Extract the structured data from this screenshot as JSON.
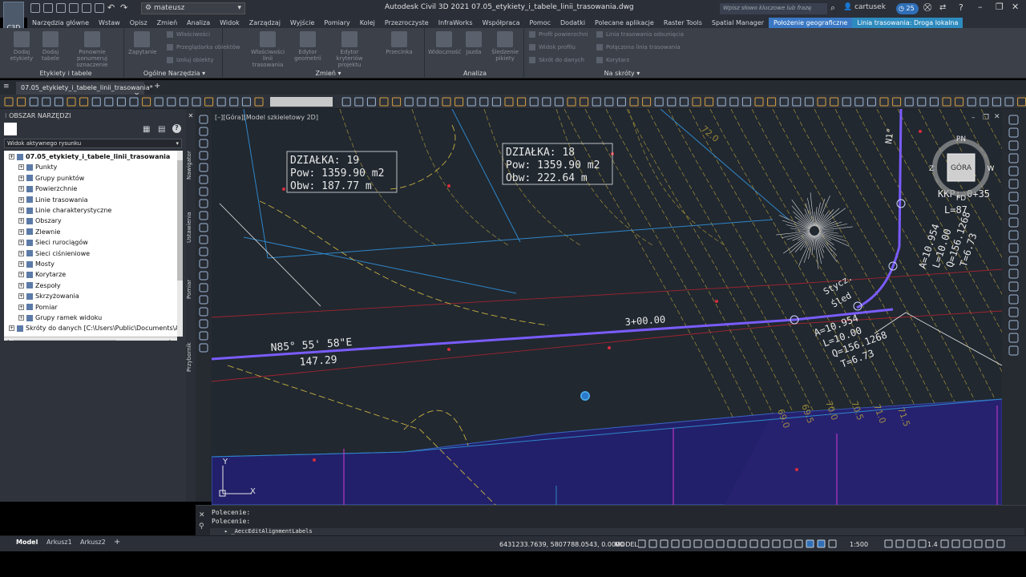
{
  "app": {
    "logo": "C3D",
    "workspace": "mateusz",
    "title": "Autodesk Civil 3D 2021   07.05_etykiety_i_tabele_linii_trasowania.dwg",
    "search_placeholder": "Wpisz słowo kluczowe lub frazę",
    "user": "cartusek",
    "notification_count": "25"
  },
  "ribbon_tabs": [
    "Narzędzia główne",
    "Wstaw",
    "Opisz",
    "Zmień",
    "Analiza",
    "Widok",
    "Zarządzaj",
    "Wyjście",
    "Pomiary",
    "Kolej",
    "Przezroczyste",
    "InfraWorks",
    "Współpraca",
    "Pomoc",
    "Dodatki",
    "Polecane aplikacje",
    "Raster Tools",
    "Spatial Manager",
    "Położenie geograficzne",
    "Linia trasowania: Droga lokalna"
  ],
  "ribbon": {
    "panel1": {
      "title": "Etykiety i tabele",
      "buttons": [
        "Dodaj etykiety",
        "Dodaj tabele",
        "Ponownie ponumeruj oznaczenie"
      ]
    },
    "panel2": {
      "title": "Ogólne Narzędzia",
      "buttons": [
        "Zapytanie"
      ],
      "small": [
        "Właściwości",
        "Przeglądarka obiektów",
        "Izoluj obiekty"
      ]
    },
    "panel3": {
      "title": "Zmień",
      "buttons": [
        "Właściwości linii trasowania",
        "Edytor geometrii",
        "Edytor kryteriów projektu",
        "Przecinka"
      ]
    },
    "panel4": {
      "title": "Analiza",
      "buttons": [
        "Widoczność",
        "Jazda",
        "Śledzenie pikiety"
      ]
    },
    "panel5": {
      "title": "Na skróty",
      "small": [
        "Profil powierzchni",
        "Widok profilu",
        "Skrót do danych",
        "Linia trasowania odsunięcia",
        "Połączona linia trasowania",
        "Korytarz"
      ]
    }
  },
  "document_tab": "07.05_etykiety_i_tabele_linii_trasowania*",
  "toolspace": {
    "title": "OBSZAR NARZĘDZI",
    "view_combo": "Widok aktywnego rysunku",
    "tree": [
      {
        "label": "07.05_etykiety_i_tabele_linii_trasowania",
        "level": 0,
        "bold": true
      },
      {
        "label": "Punkty",
        "level": 1
      },
      {
        "label": "Grupy punktów",
        "level": 1
      },
      {
        "label": "Powierzchnie",
        "level": 1
      },
      {
        "label": "Linie trasowania",
        "level": 1
      },
      {
        "label": "Linie charakterystyczne",
        "level": 1
      },
      {
        "label": "Obszary",
        "level": 1
      },
      {
        "label": "Zlewnie",
        "level": 1
      },
      {
        "label": "Sieci rurociągów",
        "level": 1
      },
      {
        "label": "Sieci ciśnieniowe",
        "level": 1
      },
      {
        "label": "Mosty",
        "level": 1
      },
      {
        "label": "Korytarze",
        "level": 1
      },
      {
        "label": "Zespoły",
        "level": 1
      },
      {
        "label": "Skrzyżowania",
        "level": 1
      },
      {
        "label": "Pomiar",
        "level": 1
      },
      {
        "label": "Grupy ramek widoku",
        "level": 1
      },
      {
        "label": "Skróty do danych [C:\\Users\\Public\\Documents\\A...",
        "level": 0
      }
    ],
    "vertical_tabs": [
      "Nawigator",
      "Ustawienia",
      "Pomiar",
      "Przybornik"
    ]
  },
  "viewport": {
    "label": "[–][Góra][Model szkieletowy 2D]",
    "parcels": [
      {
        "name": "DZIAŁKA: 19",
        "area": "Pow: 1359.90 m2",
        "perimeter": "Obw: 187.77  m"
      },
      {
        "name": "DZIAŁKA: 18",
        "area": "Pow: 1359.90 m2",
        "perimeter": "Obw: 222.64  m"
      }
    ],
    "bearing": "N85° 55' 58\"E",
    "length": "147.29",
    "station": "3+00.00",
    "curve1": [
      "A=10.954",
      "L=10.00",
      "Q=156.1268",
      "T=6.73"
    ],
    "curve2": [
      "A=10.954",
      "L=10.00",
      "Q=156.1268",
      "T=6.73"
    ],
    "label_kkp": "KKP: 0+35",
    "label_l": "L=87",
    "label_n1": "N1°",
    "label_stycz": "Stycz.",
    "label_sled": "Śled",
    "contours": [
      "72.0",
      "69.0",
      "69.5",
      "70.0",
      "70.5",
      "71.0",
      "71.5"
    ],
    "viewcube": {
      "top": "GÓRA",
      "n": "PN",
      "w": "W",
      "e": "Z",
      "s": "PD"
    },
    "ucs": {
      "x": "X",
      "y": "Y"
    }
  },
  "command": {
    "history": [
      "Polecenie:",
      "Polecenie:"
    ],
    "input": "_AeccEditAlignmentLabels"
  },
  "status": {
    "layouts": [
      "Model",
      "Arkusz1",
      "Arkusz2"
    ],
    "coords": "6431233.7639, 5807788.0543, 0.0000",
    "mode": "MODEL",
    "scale": "1:500",
    "zoom": "1.4"
  },
  "colors": {
    "accent": "#3a78c4",
    "alignment": "#7a5cff",
    "parcel": "#2f86c8",
    "contour": "#c8b040"
  }
}
